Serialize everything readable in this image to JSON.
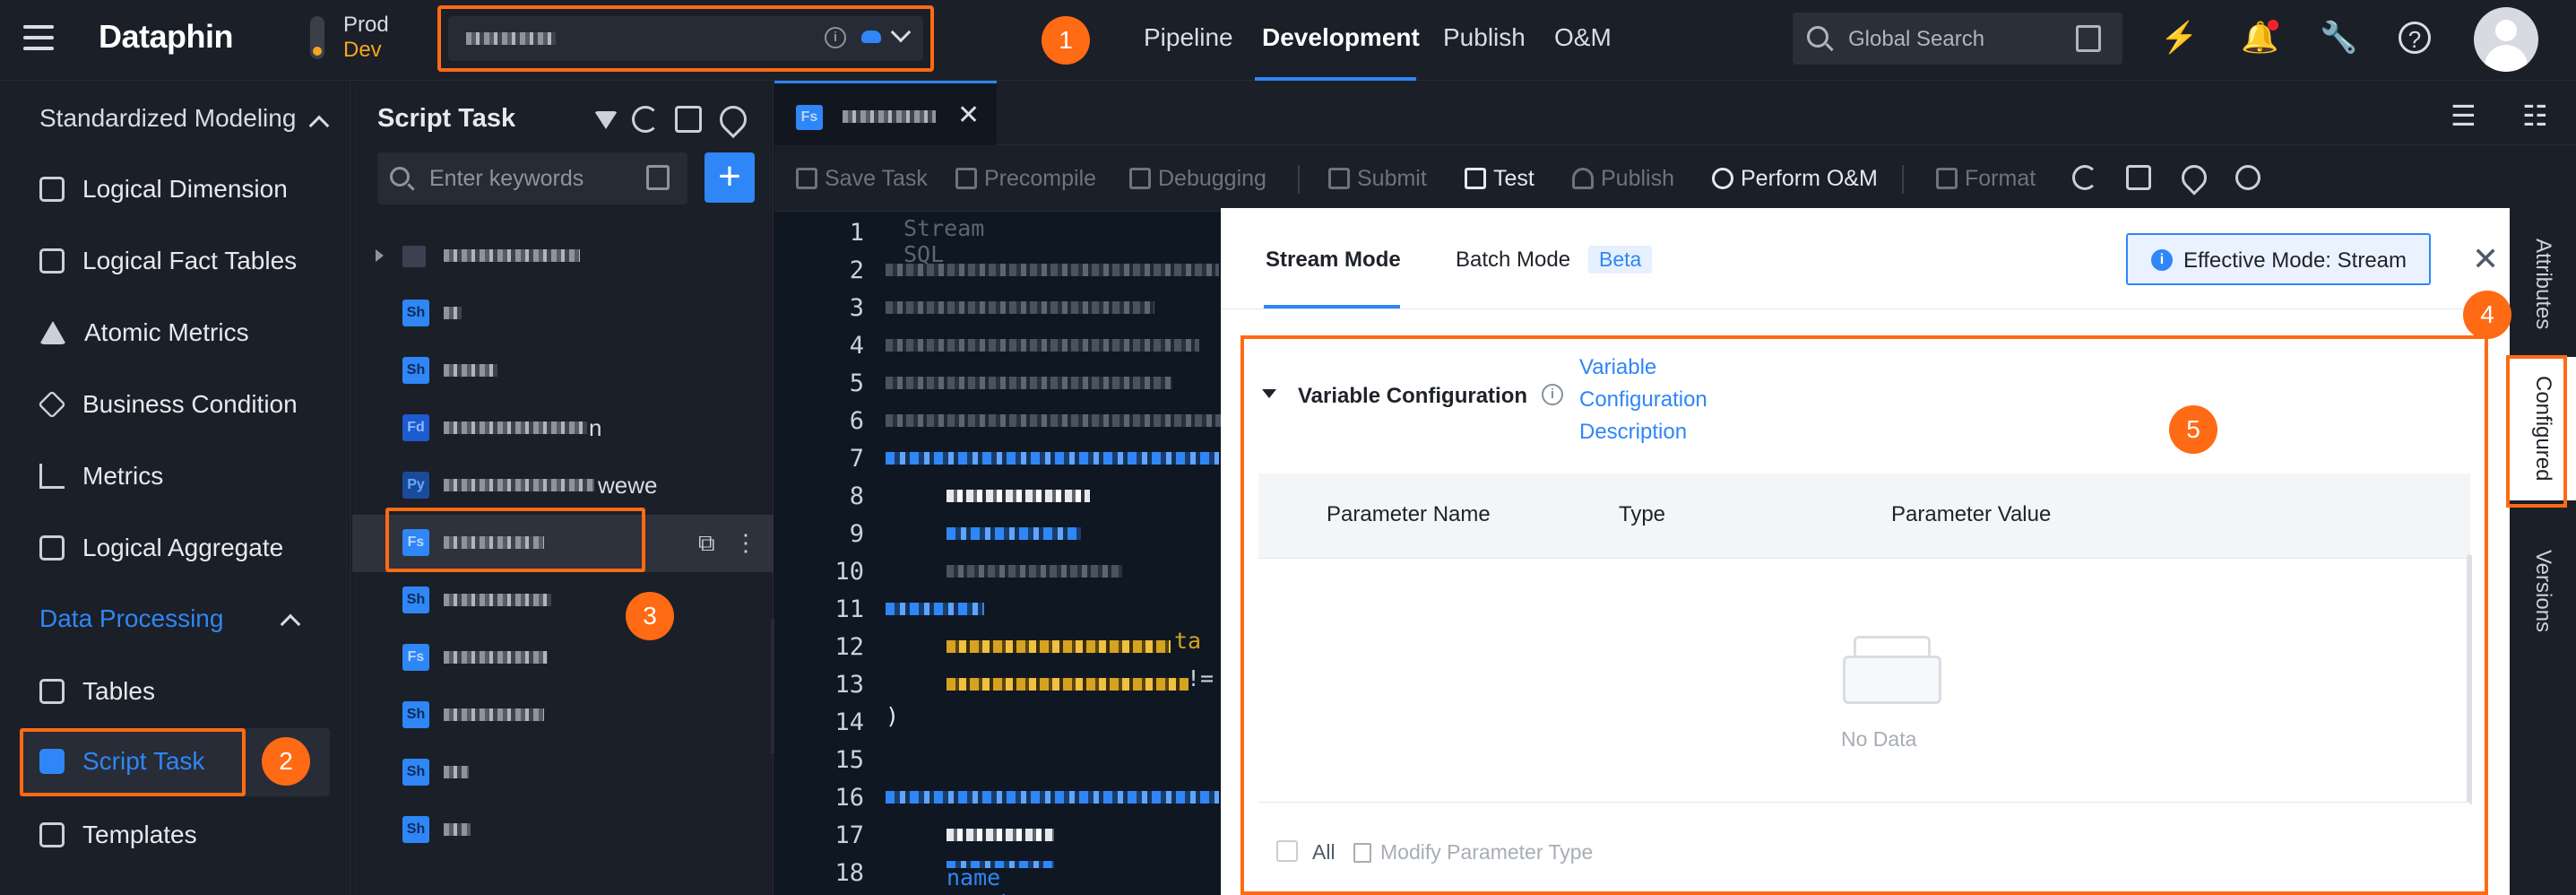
{
  "brand": {
    "accent": "#2f86f6",
    "annotation": "#ff6a14"
  },
  "header": {
    "logo": "Dataphin",
    "env": {
      "prod": "Prod",
      "dev": "Dev"
    },
    "nav": [
      {
        "label": "Pipeline"
      },
      {
        "label": "Development"
      },
      {
        "label": "Publish"
      },
      {
        "label": "O&M"
      }
    ],
    "search_label": "Global Search",
    "icons": [
      "lightning-icon",
      "bell-icon",
      "wrench-icon",
      "help-icon"
    ]
  },
  "annotations": [
    "1",
    "2",
    "3",
    "4",
    "5"
  ],
  "sidebar": {
    "section_modeling": "Standardized Modeling",
    "modeling_items": [
      {
        "label": "Logical Dimension",
        "icon": "logical-dimension-icon"
      },
      {
        "label": "Logical Fact Tables",
        "icon": "fact-table-icon"
      },
      {
        "label": "Atomic Metrics",
        "icon": "atomic-metric-icon"
      },
      {
        "label": "Business Condition",
        "icon": "business-condition-icon"
      },
      {
        "label": "Metrics",
        "icon": "metrics-icon"
      },
      {
        "label": "Logical Aggregate",
        "icon": "logical-aggregate-icon"
      }
    ],
    "section_processing": "Data Processing",
    "processing_items": [
      {
        "label": "Tables",
        "icon": "tables-icon"
      },
      {
        "label": "Script Task",
        "icon": "script-task-icon"
      },
      {
        "label": "Templates",
        "icon": "templates-icon"
      }
    ]
  },
  "file_panel": {
    "title": "Script Task",
    "search_placeholder": "Enter keywords",
    "add_label": "+",
    "files": [
      {
        "type": "",
        "name_visible": ""
      },
      {
        "type": "Sh",
        "name_visible": ""
      },
      {
        "type": "Sh",
        "name_visible": ""
      },
      {
        "type": "Fd",
        "name_visible": "n"
      },
      {
        "type": "Py",
        "name_visible": "wewe"
      },
      {
        "type": "Fs",
        "name_visible": ""
      },
      {
        "type": "Sh",
        "name_visible": ""
      },
      {
        "type": "Fs",
        "name_visible": ""
      },
      {
        "type": "Sh",
        "name_visible": ""
      },
      {
        "type": "Sh",
        "name_visible": ""
      },
      {
        "type": "Sh",
        "name_visible": ""
      }
    ]
  },
  "editor": {
    "tab_type": "Fs",
    "toolbar": [
      {
        "label": "Save Task",
        "enabled": false
      },
      {
        "label": "Precompile",
        "enabled": false
      },
      {
        "label": "Debugging",
        "enabled": false
      },
      {
        "label": "Submit",
        "enabled": false
      },
      {
        "label": "Test",
        "enabled": true
      },
      {
        "label": "Publish",
        "enabled": false
      },
      {
        "label": "Perform O&M",
        "enabled": true
      },
      {
        "label": "Format",
        "enabled": false
      }
    ],
    "line_numbers": [
      "1",
      "2",
      "3",
      "4",
      "5",
      "6",
      "7",
      "8",
      "9",
      "10",
      "11",
      "12",
      "13",
      "14",
      "15",
      "16",
      "17",
      "18"
    ],
    "code_fragments": {
      "line1": "Stream SQL",
      "line12": "ta",
      "line13": "!=",
      "line14": ")",
      "line18": "name varchar"
    }
  },
  "attributes_panel": {
    "tabs": {
      "stream": "Stream Mode",
      "batch": "Batch Mode",
      "beta": "Beta"
    },
    "effective_mode": "Effective Mode: Stream",
    "variable_section": {
      "title": "Variable Configuration",
      "link": "Variable Configuration Description",
      "columns": [
        "Parameter Name",
        "Type",
        "Parameter Value"
      ],
      "empty_text": "No Data",
      "footer": {
        "all_label": "All",
        "modify_label": "Modify Parameter Type"
      }
    }
  },
  "right_rail": {
    "tabs": [
      {
        "label": "Attributes"
      },
      {
        "label": "Configured"
      },
      {
        "label": "Versions"
      }
    ]
  }
}
